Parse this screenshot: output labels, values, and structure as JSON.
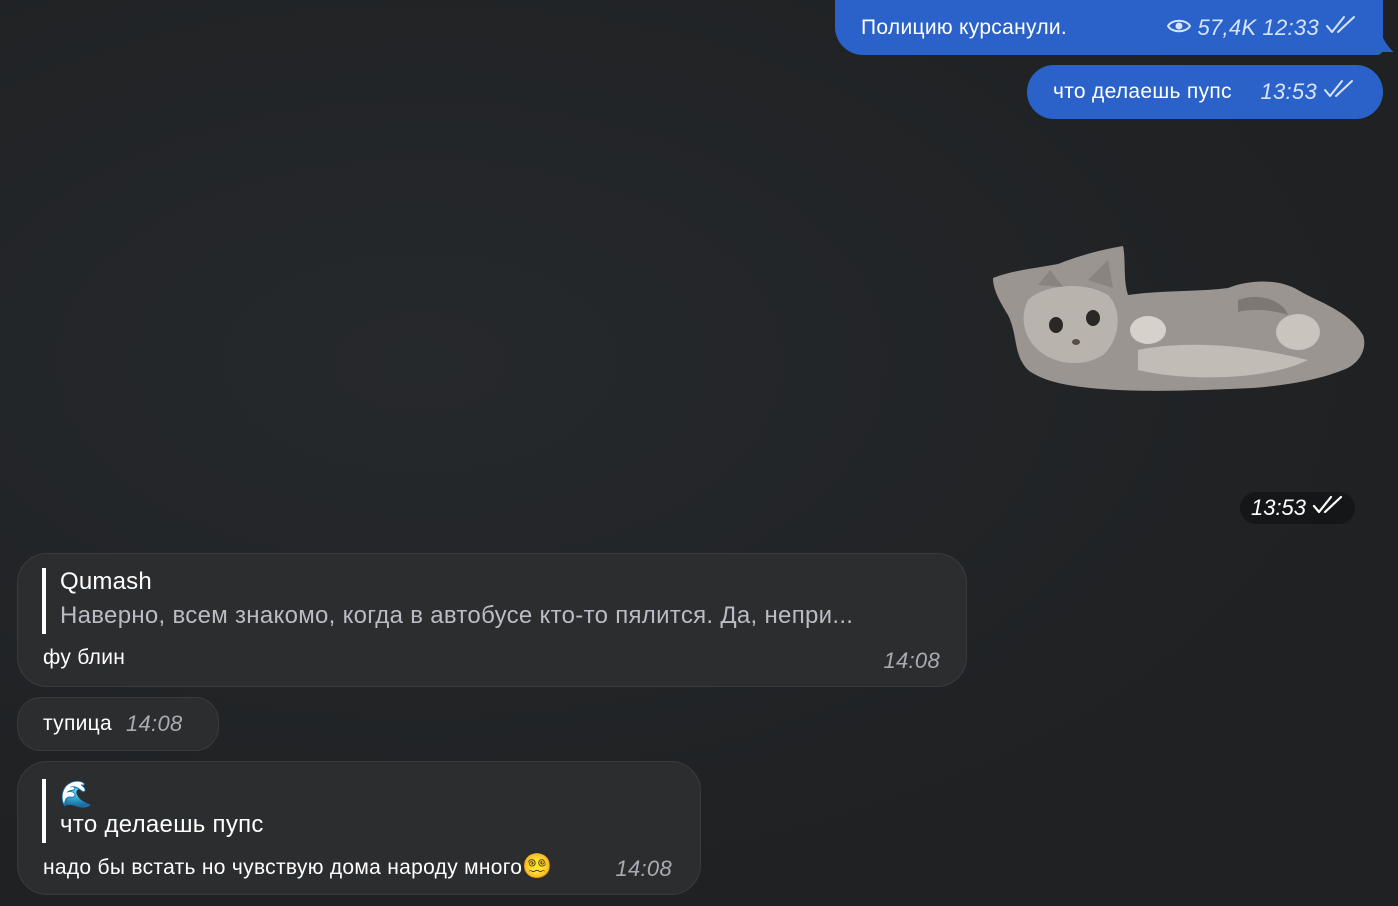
{
  "outgoing": [
    {
      "text": "Полицию курсанули.",
      "views": "57,4K",
      "time": "12:33"
    },
    {
      "text": "что делаешь пупс",
      "time": "13:53"
    }
  ],
  "sticker": {
    "icon": "kitten-sticker",
    "time": "13:53"
  },
  "incoming": [
    {
      "reply_name": "Qumash",
      "reply_text": "Наверно, всем знакомо, когда в автобусе кто-то пялится. Да, непри...",
      "text": "фу блин",
      "time": "14:08"
    },
    {
      "text": "тупица",
      "time": "14:08"
    },
    {
      "reply_icon": "wave-emoji",
      "reply_emoji": "🌊",
      "reply_text": "что делаешь пупс",
      "text": "надо бы встать но чувствую дома народу много",
      "emoji": "😵‍💫",
      "time": "14:08"
    }
  ],
  "colors": {
    "background": "#222426",
    "outgoing_bubble": "#2a62c9",
    "incoming_bubble": "#2c2d2f"
  }
}
